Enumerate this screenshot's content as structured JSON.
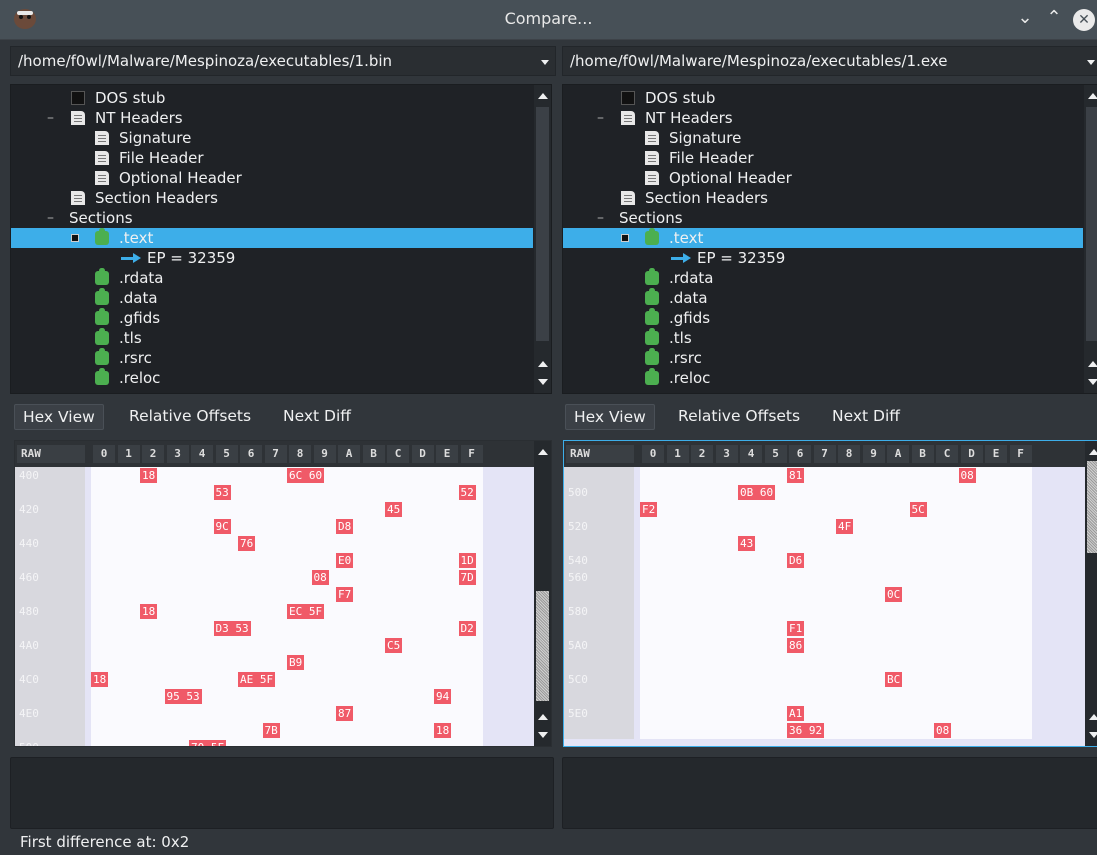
{
  "window": {
    "title": "Compare..."
  },
  "paths": {
    "left": "/home/f0wl/Malware/Mespinoza/executables/1.bin",
    "right": "/home/f0wl/Malware/Mespinoza/executables/1.exe"
  },
  "tree": {
    "dos_stub": "DOS stub",
    "nt_headers": "NT Headers",
    "signature": "Signature",
    "file_header": "File Header",
    "optional_header": "Optional Header",
    "section_headers": "Section Headers",
    "sections": "Sections",
    "text": ".text",
    "ep": "EP = 32359",
    "rdata": ".rdata",
    "data": ".data",
    "gfids": ".gfids",
    "tls": ".tls",
    "rsrc": ".rsrc",
    "reloc": ".reloc"
  },
  "tabs": {
    "hex_view": "Hex View",
    "relative_offsets": "Relative Offsets",
    "next_diff": "Next Diff"
  },
  "hex_header": {
    "raw": "RAW",
    "cols": [
      "0",
      "1",
      "2",
      "3",
      "4",
      "5",
      "6",
      "7",
      "8",
      "9",
      "A",
      "B",
      "C",
      "D",
      "E",
      "F"
    ]
  },
  "hex_left": {
    "rows": [
      {
        "addr": "400",
        "diffs": [
          {
            "col": 2,
            "text": "18"
          },
          {
            "col": 8,
            "text": "6C 60"
          }
        ]
      },
      {
        "addr": "",
        "diffs": [
          {
            "col": 5,
            "text": "53"
          },
          {
            "col": 15,
            "text": "52"
          }
        ]
      },
      {
        "addr": "420",
        "diffs": [
          {
            "col": 12,
            "text": "45"
          }
        ]
      },
      {
        "addr": "",
        "diffs": [
          {
            "col": 5,
            "text": "9C"
          },
          {
            "col": 10,
            "text": "D8"
          }
        ]
      },
      {
        "addr": "440",
        "diffs": [
          {
            "col": 6,
            "text": "76"
          }
        ]
      },
      {
        "addr": "",
        "diffs": [
          {
            "col": 10,
            "text": "E0"
          },
          {
            "col": 15,
            "text": "1D"
          }
        ]
      },
      {
        "addr": "460",
        "diffs": [
          {
            "col": 9,
            "text": "08"
          },
          {
            "col": 15,
            "text": "7D"
          }
        ]
      },
      {
        "addr": "",
        "diffs": [
          {
            "col": 10,
            "text": "F7"
          }
        ]
      },
      {
        "addr": "480",
        "diffs": [
          {
            "col": 2,
            "text": "18"
          },
          {
            "col": 8,
            "text": "EC 5F"
          }
        ]
      },
      {
        "addr": "",
        "diffs": [
          {
            "col": 5,
            "text": "D3 53"
          },
          {
            "col": 15,
            "text": "D2"
          }
        ]
      },
      {
        "addr": "4A0",
        "diffs": [
          {
            "col": 12,
            "text": "C5"
          }
        ]
      },
      {
        "addr": "",
        "diffs": [
          {
            "col": 8,
            "text": "B9"
          }
        ]
      },
      {
        "addr": "4C0",
        "diffs": [
          {
            "col": 0,
            "text": "18"
          },
          {
            "col": 6,
            "text": "AE 5F"
          }
        ]
      },
      {
        "addr": "",
        "diffs": [
          {
            "col": 3,
            "text": "95 53"
          },
          {
            "col": 14,
            "text": "94"
          }
        ]
      },
      {
        "addr": "4E0",
        "diffs": [
          {
            "col": 10,
            "text": "87"
          }
        ]
      },
      {
        "addr": "",
        "diffs": [
          {
            "col": 7,
            "text": "7B"
          },
          {
            "col": 14,
            "text": "18"
          }
        ]
      },
      {
        "addr": "500",
        "diffs": [
          {
            "col": 4,
            "text": "70 5F"
          }
        ]
      }
    ]
  },
  "hex_right": {
    "rows": [
      {
        "addr": "",
        "diffs": [
          {
            "col": 6,
            "text": "81"
          },
          {
            "col": 13,
            "text": "08"
          }
        ]
      },
      {
        "addr": "500",
        "diffs": [
          {
            "col": 4,
            "text": "0B 60"
          }
        ]
      },
      {
        "addr": "",
        "diffs": [
          {
            "col": 0,
            "text": "F2"
          },
          {
            "col": 11,
            "text": "5C"
          }
        ]
      },
      {
        "addr": "520",
        "diffs": [
          {
            "col": 8,
            "text": "4F"
          }
        ]
      },
      {
        "addr": "",
        "diffs": [
          {
            "col": 4,
            "text": "43"
          }
        ]
      },
      {
        "addr": "540",
        "diffs": [
          {
            "col": 6,
            "text": "D6"
          }
        ]
      },
      {
        "addr": "560",
        "diffs": []
      },
      {
        "addr": "",
        "diffs": [
          {
            "col": 10,
            "text": "0C"
          }
        ]
      },
      {
        "addr": "580",
        "diffs": []
      },
      {
        "addr": "",
        "diffs": [
          {
            "col": 6,
            "text": "F1"
          }
        ]
      },
      {
        "addr": "5A0",
        "diffs": [
          {
            "col": 6,
            "text": "86"
          }
        ]
      },
      {
        "addr": "",
        "diffs": []
      },
      {
        "addr": "5C0",
        "diffs": [
          {
            "col": 10,
            "text": "BC"
          }
        ]
      },
      {
        "addr": "",
        "diffs": []
      },
      {
        "addr": "5E0",
        "diffs": [
          {
            "col": 6,
            "text": "A1"
          }
        ]
      },
      {
        "addr": "",
        "diffs": [
          {
            "col": 6,
            "text": "36 92"
          },
          {
            "col": 12,
            "text": "08"
          }
        ]
      }
    ]
  },
  "status": {
    "text": "First difference at: 0x2"
  },
  "colors": {
    "accent": "#3daee9",
    "diff": "#f05a68",
    "bg": "#31363b"
  }
}
